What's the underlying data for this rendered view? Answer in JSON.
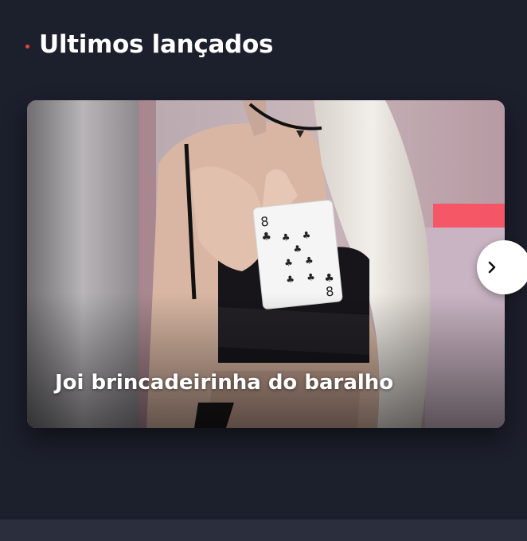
{
  "section": {
    "title": "Ultimos lançados",
    "bullet_color": "#e0463c"
  },
  "carousel": {
    "items": [
      {
        "title": "Joi brincadeirinha do baralho"
      }
    ],
    "next_icon": "chevron-right-icon"
  },
  "colors": {
    "background": "#1c1f2c",
    "bottom_bar": "#2a2e3d"
  }
}
